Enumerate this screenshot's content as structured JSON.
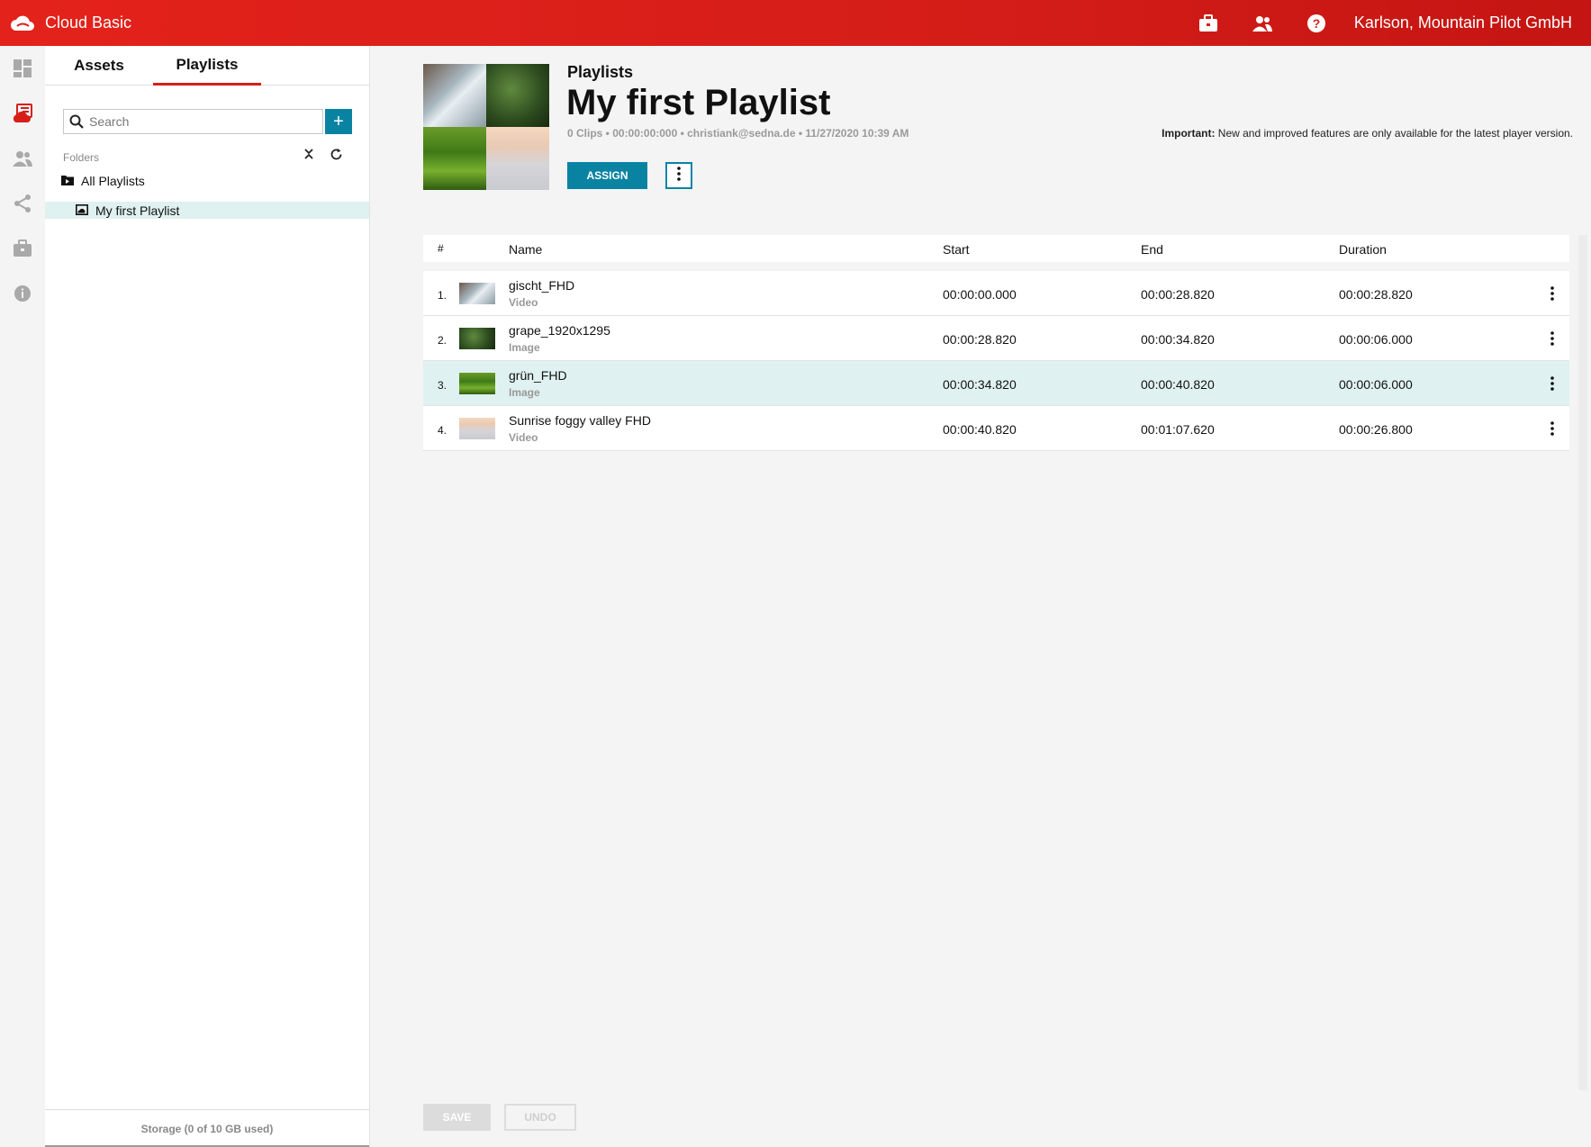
{
  "app": {
    "name": "Cloud Basic",
    "user": "Karlson, Mountain Pilot GmbH"
  },
  "topbar_icons": [
    "briefcase-icon",
    "users-icon",
    "help-icon"
  ],
  "rail_icons": [
    "dashboard-icon",
    "playlists-icon",
    "people-icon",
    "share-icon",
    "briefcase-icon",
    "info-icon"
  ],
  "side": {
    "tabs": [
      "Assets",
      "Playlists"
    ],
    "active_tab": "Playlists",
    "search_placeholder": "Search",
    "add_label": "+",
    "folders_label": "Folders",
    "tree": {
      "root": "All Playlists",
      "selected": "My first Playlist"
    },
    "storage": "Storage (0 of 10 GB used)"
  },
  "header": {
    "breadcrumb": "Playlists",
    "title": "My first Playlist",
    "meta": "0 Clips • 00:00:00:000 • christiank@sedna.de • 11/27/2020 10:39 AM",
    "notice_bold": "Important:",
    "notice_text": " New and improved features are only available for the latest player version.",
    "assign_label": "ASSIGN"
  },
  "table": {
    "headers": {
      "num": "#",
      "name": "Name",
      "start": "Start",
      "end": "End",
      "duration": "Duration"
    },
    "rows": [
      {
        "num": "1.",
        "name": "gischt_FHD",
        "type": "Video",
        "start": "00:00:00.000",
        "end": "00:00:28.820",
        "duration": "00:00:28.820"
      },
      {
        "num": "2.",
        "name": "grape_1920x1295",
        "type": "Image",
        "start": "00:00:28.820",
        "end": "00:00:34.820",
        "duration": "00:00:06.000"
      },
      {
        "num": "3.",
        "name": "grün_FHD",
        "type": "Image",
        "start": "00:00:34.820",
        "end": "00:00:40.820",
        "duration": "00:00:06.000"
      },
      {
        "num": "4.",
        "name": "Sunrise foggy valley FHD",
        "type": "Video",
        "start": "00:00:40.820",
        "end": "00:01:07.620",
        "duration": "00:00:26.800"
      }
    ],
    "selected_row": 3
  },
  "footer": {
    "save_label": "SAVE",
    "undo_label": "UNDO"
  },
  "colors": {
    "brand_red": "#d61f18",
    "accent_teal": "#0a83a3",
    "selection": "#dff1f0"
  }
}
